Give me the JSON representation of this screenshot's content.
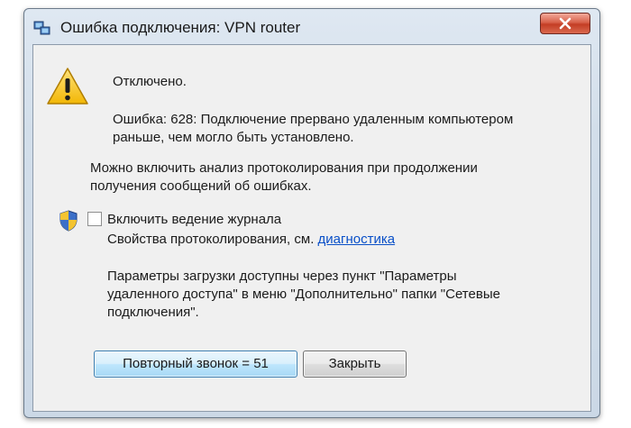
{
  "window": {
    "title": "Ошибка подключения: VPN router",
    "close_icon": "close-icon",
    "title_icon": "network-icon"
  },
  "dialog": {
    "status": "Отключено.",
    "error_line1": "Ошибка: 628: Подключение прервано удаленным компьютером",
    "error_line2": "раньше, чем могло быть установлено.",
    "logging_hint_line1": "Можно включить анализ протоколирования при продолжении",
    "logging_hint_line2": "получения сообщений об ошибках.",
    "checkbox_label": "Включить ведение журнала",
    "checkbox_checked": false,
    "diagnostics_prefix": "Свойства протоколирования, см.",
    "diagnostics_link": "диагностика",
    "params_line1": "Параметры загрузки доступны через пункт \"Параметры",
    "params_line2": "удаленного доступа\" в меню \"Дополнительно\" папки \"Сетевые",
    "params_line3": "подключения\".",
    "redial_button": "Повторный звонок = 51",
    "close_button": "Закрыть",
    "warning_icon": "warning-icon",
    "shield_icon": "uac-shield-icon"
  }
}
